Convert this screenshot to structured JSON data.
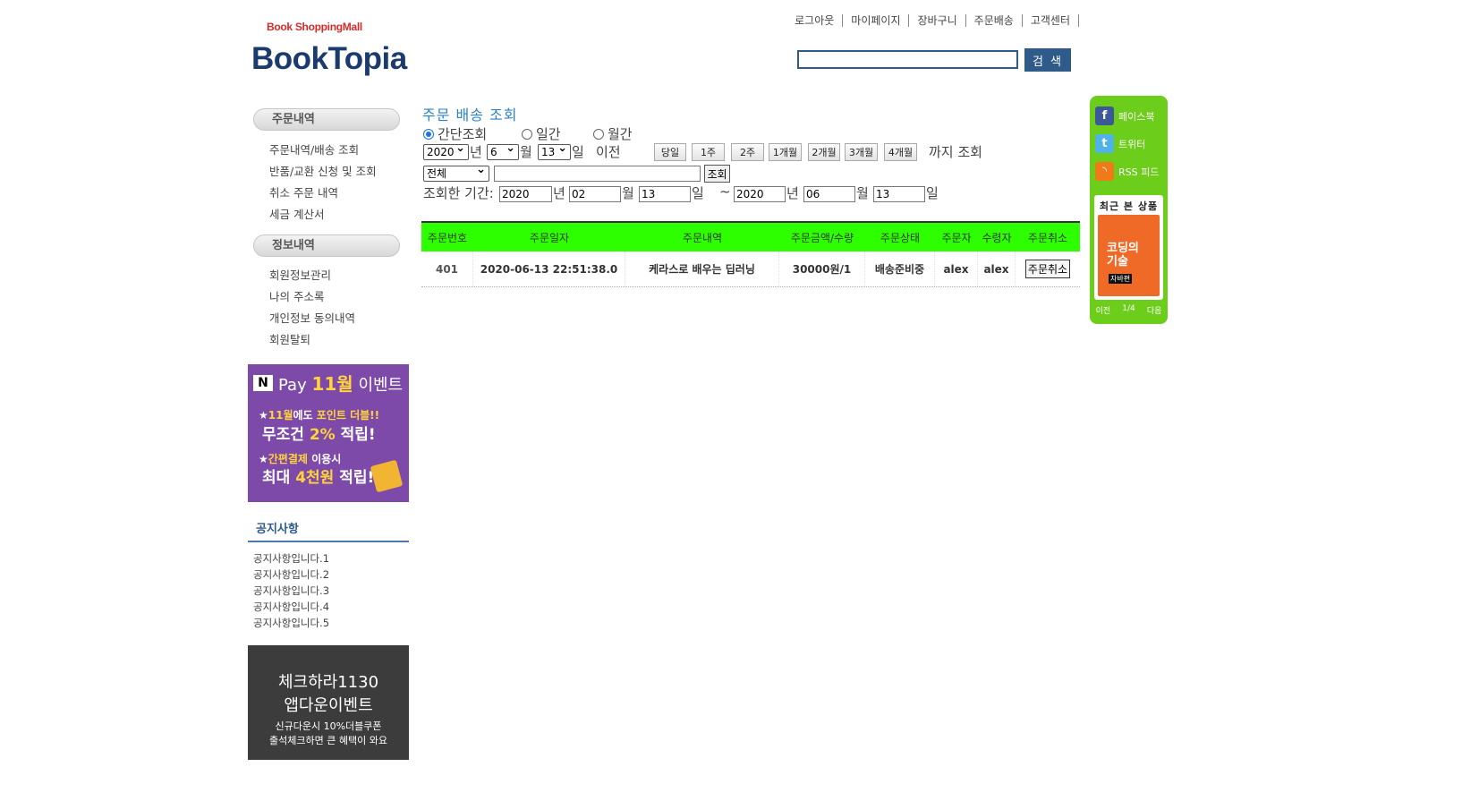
{
  "brand": {
    "sub": "Book ShoppingMall",
    "main": "BookTopia"
  },
  "topnav": [
    "로그아웃",
    "마이페이지",
    "장바구니",
    "주문배송",
    "고객센터"
  ],
  "search": {
    "value": "",
    "button": "검 색"
  },
  "sidebar": {
    "order_head": "주문내역",
    "order_items": [
      "주문내역/배송 조회",
      "반품/교환 신청 및 조회",
      "취소 주문 내역",
      "세금 계산서"
    ],
    "info_head": "정보내역",
    "info_items": [
      "회원정보관리",
      "나의 주소록",
      "개인정보 동의내역",
      "회원탈퇴"
    ]
  },
  "npay_banner": {
    "n": "N",
    "pay": "Pay",
    "month": "11월",
    "event": "이벤트",
    "l1a": "11월",
    "l1b": "에도 ",
    "l1c": "포인트 더블!!",
    "l2a": "무조건 ",
    "l2b": "2%",
    "l2c": " 적립!",
    "l3a": "간편결제",
    "l3b": " 이용시",
    "l4a": "최대 ",
    "l4b": "4천원",
    "l4c": " 적립!"
  },
  "notice": {
    "title": "공지사항",
    "items": [
      "공지사항입니다.1",
      "공지사항입니다.2",
      "공지사항입니다.3",
      "공지사항입니다.4",
      "공지사항입니다.5"
    ]
  },
  "check_banner": {
    "l1": "체크하라1130",
    "l2": "앱다운이벤트",
    "l3": "신규다운시 10%더블쿠폰",
    "l4": "출석체크하면 큰 혜택이 와요"
  },
  "main": {
    "title": "주문 배송 조회",
    "radios": {
      "simple": "간단조회",
      "daily": "일간",
      "monthly": "월간"
    },
    "year": "2020",
    "month": "6",
    "day": "13",
    "unit_year": "년",
    "unit_month": "월",
    "unit_day": "일",
    "before": "이전",
    "periods": [
      "당일",
      "1주",
      "2주",
      "1개월",
      "2개월",
      "3개월",
      "4개월"
    ],
    "until": "까지 조회",
    "category": "전체",
    "keyword": "",
    "query_button": "조회",
    "range_label": "조회한 기간:",
    "from": {
      "year": "2020",
      "month": "02",
      "day": "13"
    },
    "tilde": "~",
    "to": {
      "year": "2020",
      "month": "06",
      "day": "13"
    }
  },
  "table": {
    "headers": [
      "주문번호",
      "주문일자",
      "주문내역",
      "주문금액/수량",
      "주문상태",
      "주문자",
      "수령자",
      "주문취소"
    ],
    "rows": [
      {
        "no": "401",
        "date": "2020-06-13 22:51:38.0",
        "item": "케라스로 배우는 딥러닝",
        "amount": "30000원/1",
        "status": "배송준비중",
        "orderer": "alex",
        "receiver": "alex",
        "cancel": "주문취소"
      }
    ]
  },
  "quick": {
    "facebook": "페이스북",
    "twitter": "트위터",
    "rss": "RSS 피드",
    "recent_title": "최근 본 상품",
    "book_title_1": "코딩의",
    "book_title_2": "기술",
    "book_badge": "자바편",
    "prev": "이전",
    "page": "1/4",
    "next": "다음"
  },
  "colors": {
    "header_green": "#2eff00",
    "quick_green": "#6dcd1b",
    "brand_navy": "#1b3a6e",
    "accent_blue": "#2b83c4"
  }
}
